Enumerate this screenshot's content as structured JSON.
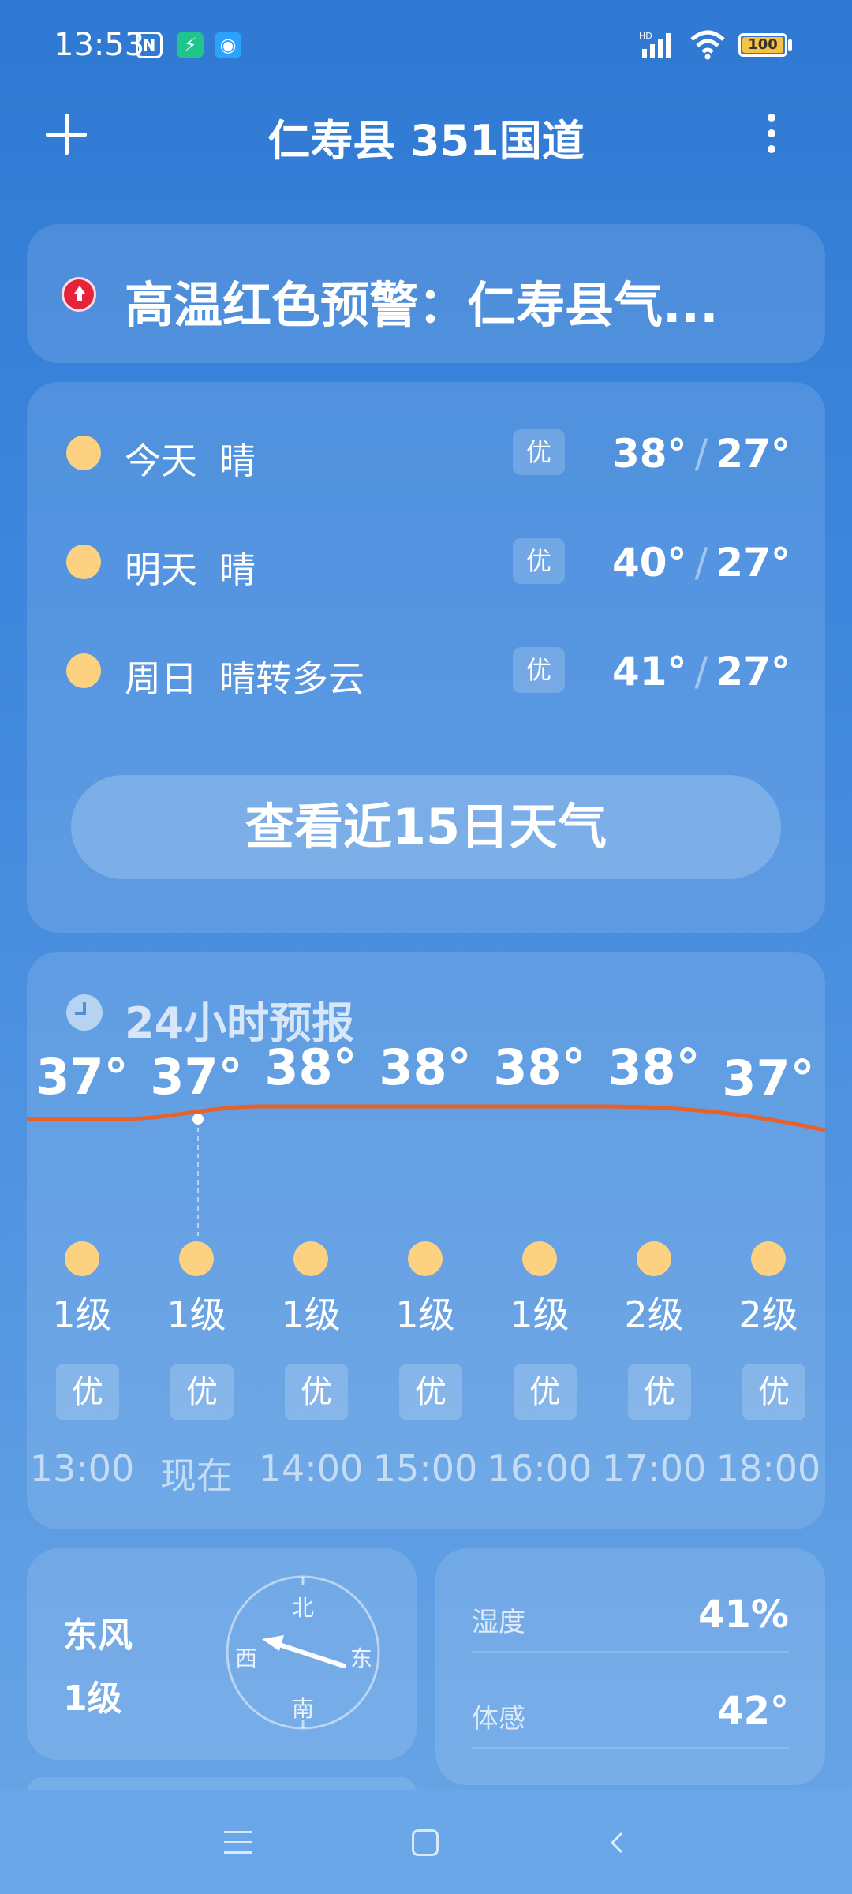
{
  "status": {
    "time": "13:53",
    "battery": "100",
    "signal_label": "HD"
  },
  "header": {
    "title": "仁寿县 351国道"
  },
  "alert": {
    "text": "高温红色预警：仁寿县气..."
  },
  "forecast": {
    "days": [
      {
        "day": "今天",
        "condition": "晴",
        "aqi": "优",
        "high": "38°",
        "low": "27°"
      },
      {
        "day": "明天",
        "condition": "晴",
        "aqi": "优",
        "high": "40°",
        "low": "27°"
      },
      {
        "day": "周日",
        "condition": "晴转多云",
        "aqi": "优",
        "high": "41°",
        "low": "27°"
      }
    ],
    "button_label": "查看近15日天气"
  },
  "hourly": {
    "title": "24小时预报",
    "items": [
      {
        "temp": "37°",
        "wind": "1级",
        "aqi": "优",
        "time": "13:00"
      },
      {
        "temp": "37°",
        "wind": "1级",
        "aqi": "优",
        "time": "现在"
      },
      {
        "temp": "38°",
        "wind": "1级",
        "aqi": "优",
        "time": "14:00"
      },
      {
        "temp": "38°",
        "wind": "1级",
        "aqi": "优",
        "time": "15:00"
      },
      {
        "temp": "38°",
        "wind": "1级",
        "aqi": "优",
        "time": "16:00"
      },
      {
        "temp": "38°",
        "wind": "2级",
        "aqi": "优",
        "time": "17:00"
      },
      {
        "temp": "37°",
        "wind": "2级",
        "aqi": "优",
        "time": "18:00"
      }
    ]
  },
  "wind": {
    "direction": "东风",
    "level": "1级",
    "compass": {
      "n": "北",
      "s": "南",
      "w": "西",
      "e": "东"
    }
  },
  "details": [
    {
      "label": "湿度",
      "value": "41%"
    },
    {
      "label": "体感",
      "value": "42°"
    }
  ],
  "colors": {
    "curve": "#e8602a",
    "sun": "#fdd182",
    "alert": "#e5243b"
  }
}
